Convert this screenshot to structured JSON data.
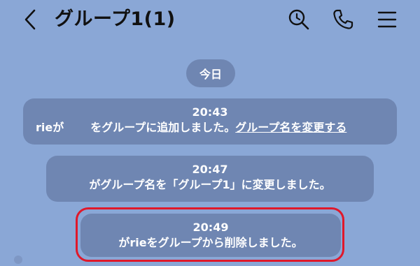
{
  "header": {
    "title": "グループ1(1)",
    "icons": [
      "back-chevron-icon",
      "search-icon",
      "phone-icon",
      "menu-icon"
    ]
  },
  "date_separator": "今日",
  "messages": [
    {
      "time": "20:43",
      "prefix": "rieが",
      "text": "をグループに追加しました。",
      "link": "グループ名を変更する"
    },
    {
      "time": "20:47",
      "text": "がグループ名を「グループ1」に変更しました。"
    },
    {
      "time": "20:49",
      "text": "がrieをグループから削除しました。"
    }
  ],
  "colors": {
    "background": "#8aa7d6",
    "bubble": "#6f86b2",
    "highlight": "#e0182a"
  }
}
